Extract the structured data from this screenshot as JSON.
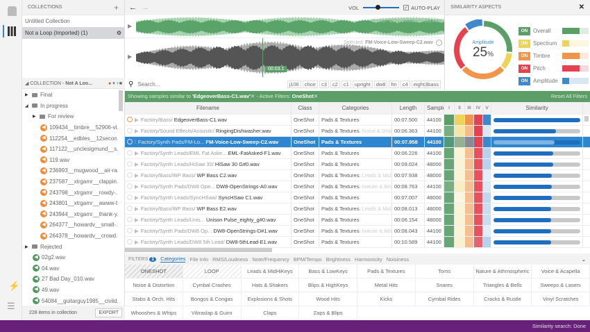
{
  "collections": {
    "header": "COLLECTIONS",
    "items": [
      {
        "label": "Untitled Collection"
      },
      {
        "label": "Not a Loop (Imported) (1)",
        "selected": true
      }
    ]
  },
  "collection": {
    "header_prefix": "COLLECTION - ",
    "header_name": "Not A Loo...",
    "tree": [
      {
        "type": "folder",
        "label": "Final",
        "depth": 0,
        "expanded": false
      },
      {
        "type": "folder",
        "label": "In progress",
        "depth": 0,
        "expanded": true
      },
      {
        "type": "folder",
        "label": "For review",
        "depth": 1,
        "expanded": false
      },
      {
        "type": "file",
        "label": "109434__timbre__52906-vl...",
        "color": "#ef8c3b",
        "depth": 2
      },
      {
        "type": "file",
        "label": "112254__edbles__12secon...",
        "color": "#ef8c3b",
        "depth": 2
      },
      {
        "type": "file",
        "label": "117122__unclesigmund__s...",
        "color": "#ef8c3b",
        "depth": 2
      },
      {
        "type": "file",
        "label": "119.wav",
        "color": "#ef8c3b",
        "depth": 2
      },
      {
        "type": "file",
        "label": "236993__mugwood__air-ra...",
        "color": "#ef8c3b",
        "depth": 2
      },
      {
        "type": "file",
        "label": "237587__xtrgamr__clappin...",
        "color": "#ef8c3b",
        "depth": 2
      },
      {
        "type": "file",
        "label": "243798__xtrgamr__rowdy-...",
        "color": "#ef8c3b",
        "depth": 2
      },
      {
        "type": "file",
        "label": "243801__xtrgamr__awww-t...",
        "color": "#ef8c3b",
        "depth": 2
      },
      {
        "type": "file",
        "label": "243944__xtrgamr__thank-y...",
        "color": "#ef8c3b",
        "depth": 2
      },
      {
        "type": "file",
        "label": "264377__howardv__small-...",
        "color": "#ef8c3b",
        "depth": 2
      },
      {
        "type": "file",
        "label": "264378__howardv__crowd...",
        "color": "#ef8c3b",
        "depth": 2
      },
      {
        "type": "folder",
        "label": "Rejected",
        "depth": 0,
        "expanded": false
      },
      {
        "type": "file",
        "label": "02g2.wav",
        "color": "#4e9a5e",
        "depth": 1
      },
      {
        "type": "file",
        "label": "04.wav",
        "color": "#4e9a5e",
        "depth": 1
      },
      {
        "type": "file",
        "label": "27 Bad Day_010.wav",
        "color": "#4e9a5e",
        "depth": 1
      },
      {
        "type": "file",
        "label": "49.wav",
        "color": "#4e9a5e",
        "depth": 1
      },
      {
        "type": "file",
        "label": "54084__guitarguy1985__civild...",
        "color": "#4e9a5e",
        "depth": 1
      },
      {
        "type": "file",
        "label": "58672__timtube__cheer-2.wav",
        "color": "#4e9a5e",
        "depth": 1,
        "selected": true
      }
    ],
    "count": "228 items in collection",
    "export": "EXPORT"
  },
  "player": {
    "vol_label": "VOL",
    "volume": 0.4,
    "autoplay_label": "AUTO-PLAY",
    "autoplay": true,
    "similar_label": "Similar: ",
    "similar_file": "EdgeoverBass-C1.wav",
    "selected_label": "Selected: ",
    "selected_file": "FM-Voice-Low-Sweep-C2.wav",
    "time": "00:03.1",
    "progress": 0.41
  },
  "search": {
    "placeholder": "Search...",
    "tags": [
      "j106",
      "choir",
      "c3",
      "c2",
      "c1",
      "upright",
      "dw8",
      "fm",
      "c4",
      "eight3bass"
    ]
  },
  "filterbar": {
    "prefix": "Showing samples similar to ",
    "file": "'EdgeoverBass-C1.wav'",
    "mid": " - Active Filters: ",
    "filter": "OneShot",
    "reset": "Reset All Filters"
  },
  "table": {
    "columns": [
      "Filename",
      "Class",
      "Categories",
      "Length",
      "Samplerate",
      "I",
      "II",
      "III",
      "IV",
      "V",
      "Similarity"
    ],
    "rows": [
      {
        "path": "Factory/Bass/ ",
        "file": "EdgeoverBass-C1.wav",
        "class": "OneShot",
        "cat": "Pads & Textures",
        "cat2": "",
        "len": "00:07.500",
        "sr": "44100",
        "aspects": [
          1,
          1,
          1,
          1,
          1
        ],
        "sim": 1.0
      },
      {
        "path": "Factory/Sound Effects/Acoustic/ ",
        "file": "RingingDishwasher.wav",
        "class": "OneShot",
        "cat": "Pads & Textures",
        "cat2": ", Noise & Disto",
        "len": "00:06.363",
        "sr": "44100",
        "aspects": [
          0.8,
          0.5,
          0.6,
          1,
          0.1
        ],
        "sim": 0.72
      },
      {
        "path": "Factory/Synth Pads/FM-Lo... ",
        "file": "FM-Voice-Low-Sweep-C2.wav",
        "class": "OneShot",
        "cat": "Pads & Textures",
        "cat2": "",
        "len": "00:07.958",
        "sr": "44100",
        "aspects": [
          0.8,
          0.5,
          0.4,
          1,
          0.6
        ],
        "sim": 0.7,
        "selected": true
      },
      {
        "path": "Factory/Synth Leads/EML Fat Aske... ",
        "file": "EML-FatAsked-F1.wav",
        "class": "OneShot",
        "cat": "Pads & Textures",
        "cat2": "",
        "len": "00:06.226",
        "sr": "44100",
        "aspects": [
          0.9,
          0.15,
          0.55,
          0.9,
          0.3
        ],
        "sim": 0.69
      },
      {
        "path": "Factory/Synth Leads/HiSaw 30/ ",
        "file": "HiSaw 30 G#0.wav",
        "class": "OneShot",
        "cat": "Pads & Textures",
        "cat2": "",
        "len": "00:09.024",
        "sr": "48000",
        "aspects": [
          0.9,
          0.15,
          0.55,
          0.9,
          0.3
        ],
        "sim": 0.69
      },
      {
        "path": "Factory/Bass/WP Bass/ ",
        "file": "WP Bass C2.wav",
        "class": "OneShot",
        "cat": "Pads & Textures",
        "cat2": ", Leads & Midi",
        "len": "00:07.938",
        "sr": "48000",
        "aspects": [
          0.9,
          0.15,
          0.55,
          0.9,
          0.05
        ],
        "sim": 0.67
      },
      {
        "path": "Factory/Synth Pads/DW8 Ope... ",
        "file": "DW8-OpenStrings-A0.wav",
        "class": "OneShot",
        "cat": "Pads & Textures",
        "cat2": ", Nature & Ath",
        "len": "00:08.763",
        "sr": "44100",
        "aspects": [
          0.8,
          0.3,
          0.55,
          0.9,
          0.1
        ],
        "sim": 0.67
      },
      {
        "path": "Factory/Synth Leads/SyncHSaw/ ",
        "file": "SyncHSaw C1.wav",
        "class": "OneShot",
        "cat": "Pads & Textures",
        "cat2": "",
        "len": "00:07.007",
        "sr": "48000",
        "aspects": [
          0.9,
          0.1,
          0.55,
          0.9,
          0.25
        ],
        "sim": 0.67
      },
      {
        "path": "Factory/Bass/WP Bass/ ",
        "file": "WP Bass E2.wav",
        "class": "OneShot",
        "cat": "Pads & Textures",
        "cat2": ", Leads & Midi",
        "len": "00:08.013",
        "sr": "48000",
        "aspects": [
          0.9,
          0.15,
          0.55,
          0.9,
          0.2
        ],
        "sim": 0.66
      },
      {
        "path": "Factory/Synth Leads/Unis... ",
        "file": "Unison Pulse_eighty_g#0.wav",
        "class": "OneShot",
        "cat": "Pads & Textures",
        "cat2": "",
        "len": "00:06.154",
        "sr": "48000",
        "aspects": [
          0.9,
          0.15,
          0.55,
          0.9,
          0.2
        ],
        "sim": 0.66
      },
      {
        "path": "Factory/Synth Pads/DW8 Op... ",
        "file": "DW8-OpenStrings-D#1.wav",
        "class": "OneShot",
        "cat": "Pads & Textures",
        "cat2": ", Nature & Ath",
        "len": "00:08.043",
        "sr": "44100",
        "aspects": [
          0.9,
          0.15,
          0.55,
          0.9,
          0.05
        ],
        "sim": 0.66
      },
      {
        "path": "Factory/Synth Leads/DW8 5th Lead/ ",
        "file": "DW8-5thLead-E1.wav",
        "class": "OneShot",
        "cat": "Pads & Textures",
        "cat2": "",
        "len": "00:10.589",
        "sr": "44100",
        "aspects": [
          0.9,
          0.2,
          0.55,
          0.8,
          0.3
        ],
        "sim": 0.66
      }
    ]
  },
  "aspects": {
    "title": "SIMILARITY ASPECTS",
    "center_label": "Amplitude",
    "center_value": "25",
    "center_unit": "%",
    "on_label": "ON",
    "items": [
      {
        "name": "Overall",
        "color": "#5a9e68",
        "weight": 0.65
      },
      {
        "name": "Spectrum",
        "color": "#edd35a",
        "weight": 0.25
      },
      {
        "name": "Timbre",
        "color": "#f0954a",
        "weight": 0.65
      },
      {
        "name": "Pitch",
        "color": "#e5414f",
        "weight": 0.65
      },
      {
        "name": "Amplitude",
        "color": "#3f88cc",
        "weight": 0.25
      }
    ]
  },
  "filters": {
    "label": "FILTERS",
    "count": "1",
    "tabs": [
      "Categories",
      "File Info",
      "RMS/Loudness",
      "Note/Frequency",
      "BPM/Tempo",
      "Brightness",
      "Harmonicity",
      "Noisiness"
    ],
    "categories": [
      "ONESHOT",
      "LOOP",
      "Leads & MidHiKeys",
      "Bass & LowKeys",
      "Pads & Textures",
      "Toms",
      "Nature & Athmospheric",
      "Voice & Acapella",
      "Noise & Distortion",
      "Cymbal Crashes",
      "Hats & Shakers",
      "Blips & HighKeys",
      "Metal Hits",
      "Snares",
      "Triangles & Bells",
      "Sweeps & Lasers",
      "Stabs & Orch. Hits",
      "Bongos & Congas",
      "Explosions & Shots",
      "Wood Hits",
      "Kicks",
      "Cymbal Rides",
      "Cracks & Rustle",
      "Vinyl Scratches",
      "Whooshes & Whips",
      "Vibraslap & Guiro",
      "Claps",
      "Zaps & Blips"
    ]
  },
  "status": "Similarity search: Done"
}
